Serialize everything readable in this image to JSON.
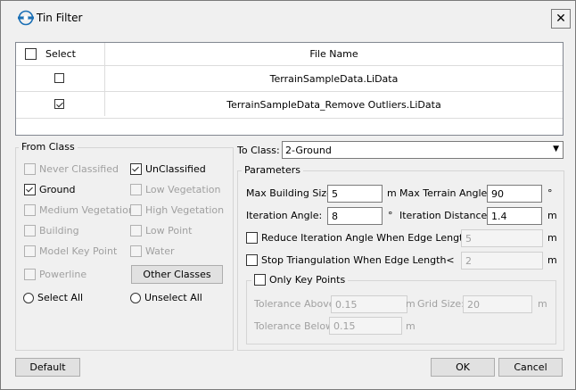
{
  "window": {
    "title": "Tin Filter",
    "close_glyph": "✕"
  },
  "file_table": {
    "headers": {
      "select": "Select",
      "file_name": "File Name"
    },
    "rows": [
      {
        "name": "TerrainSampleData.LiData",
        "checked": false
      },
      {
        "name": "TerrainSampleData_Remove Outliers.LiData",
        "checked": true
      }
    ]
  },
  "from_class": {
    "title": "From Class",
    "left_items": [
      {
        "label": "Never Classified",
        "enabled": false,
        "checked": false
      },
      {
        "label": "Ground",
        "enabled": true,
        "checked": true
      },
      {
        "label": "Medium Vegetation",
        "enabled": false,
        "checked": false
      },
      {
        "label": "Building",
        "enabled": false,
        "checked": false
      },
      {
        "label": "Model Key Point",
        "enabled": false,
        "checked": false
      },
      {
        "label": "Powerline",
        "enabled": false,
        "checked": false
      }
    ],
    "right_items": [
      {
        "label": "UnClassified",
        "enabled": true,
        "checked": true
      },
      {
        "label": "Low Vegetation",
        "enabled": false,
        "checked": false
      },
      {
        "label": "High Vegetation",
        "enabled": false,
        "checked": false
      },
      {
        "label": "Low Point",
        "enabled": false,
        "checked": false
      },
      {
        "label": "Water",
        "enabled": false,
        "checked": false
      }
    ],
    "other_classes_label": "Other Classes",
    "select_all_label": "Select All",
    "unselect_all_label": "Unselect All"
  },
  "to_class": {
    "label": "To Class:",
    "value": "2-Ground"
  },
  "parameters": {
    "title": "Parameters",
    "max_building_size": {
      "label": "Max Building Size:",
      "value": "5",
      "unit": "m"
    },
    "max_terrain_angle": {
      "label": "Max Terrain Angle:",
      "value": "90",
      "unit": "°"
    },
    "iteration_angle": {
      "label": "Iteration Angle:",
      "value": "8",
      "unit": "°"
    },
    "iteration_distance": {
      "label": "Iteration Distance:",
      "value": "1.4",
      "unit": "m"
    },
    "reduce_iteration": {
      "label": "Reduce Iteration Angle When Edge Length<",
      "value": "5",
      "unit": "m"
    },
    "stop_triangulation": {
      "label": "Stop Triangulation When Edge Length<",
      "value": "2",
      "unit": "m"
    },
    "only_key_points": {
      "label": "Only Key Points",
      "tolerance_above": {
        "label": "Tolerance Above",
        "value": "0.15",
        "unit": "m"
      },
      "grid_size": {
        "label": "Grid Size:",
        "value": "20",
        "unit": "m"
      },
      "tolerance_below": {
        "label": "Tolerance Below",
        "value": "0.15",
        "unit": "m"
      }
    }
  },
  "buttons": {
    "default": "Default",
    "ok": "OK",
    "cancel": "Cancel"
  },
  "colors": {
    "background": "#f0f0f0",
    "logo_blue": "#1a6fb5"
  }
}
